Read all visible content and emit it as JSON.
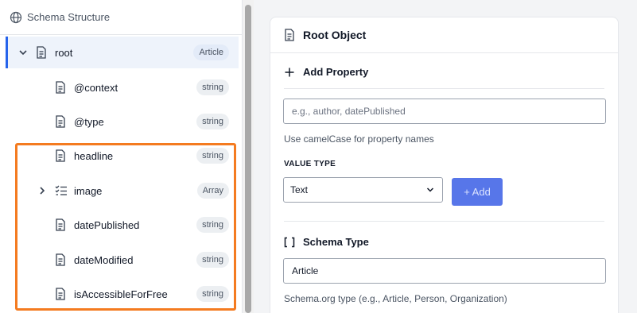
{
  "sidebar": {
    "header_title": "Schema Structure",
    "tree": [
      {
        "label": "root",
        "type": "Article",
        "icon": "document-icon",
        "expandable": true,
        "expanded": true
      },
      {
        "label": "@context",
        "type": "string",
        "icon": "document-icon"
      },
      {
        "label": "@type",
        "type": "string",
        "icon": "document-icon"
      },
      {
        "label": "headline",
        "type": "string",
        "icon": "document-icon"
      },
      {
        "label": "image",
        "type": "Array",
        "icon": "list-check-icon",
        "expandable": true,
        "expanded": false
      },
      {
        "label": "datePublished",
        "type": "string",
        "icon": "document-icon"
      },
      {
        "label": "dateModified",
        "type": "string",
        "icon": "document-icon"
      },
      {
        "label": "isAccessibleForFree",
        "type": "string",
        "icon": "document-icon"
      }
    ]
  },
  "card": {
    "title": "Root Object",
    "add_property": {
      "title": "Add Property",
      "name_placeholder": "e.g., author, datePublished",
      "name_value": "",
      "help": "Use camelCase for property names",
      "value_type_label": "VALUE TYPE",
      "value_type_selected": "Text",
      "add_button": "+ Add"
    },
    "schema_type": {
      "title": "Schema Type",
      "value": "Article",
      "help": "Schema.org type (e.g., Article, Person, Organization)"
    }
  },
  "colors": {
    "accent": "#2563eb",
    "highlight": "#f47b20",
    "button": "#4f6fe8"
  }
}
